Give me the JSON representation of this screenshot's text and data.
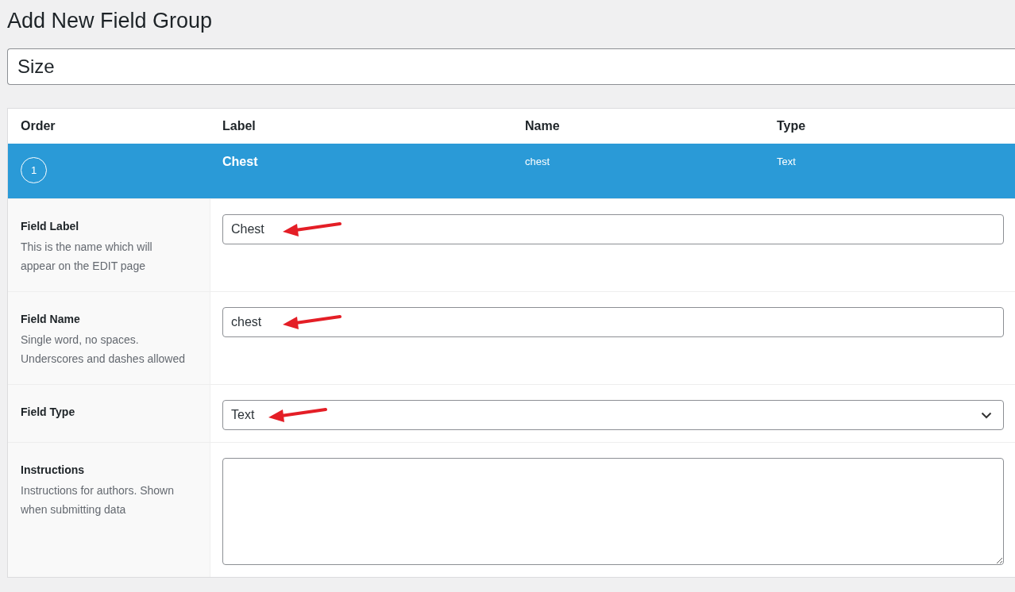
{
  "page": {
    "title": "Add New Field Group"
  },
  "group_title": {
    "value": "Size"
  },
  "table": {
    "columns": [
      "Order",
      "Label",
      "Name",
      "Type"
    ],
    "rows": [
      {
        "order": "1",
        "label": "Chest",
        "name": "chest",
        "type": "Text",
        "selected": true
      }
    ]
  },
  "settings": [
    {
      "kind": "text",
      "label": "Field Label",
      "description": "This is the name which will appear on the EDIT page",
      "value": "Chest",
      "arrow": true
    },
    {
      "kind": "text",
      "label": "Field Name",
      "description": "Single word, no spaces. Underscores and dashes allowed",
      "value": "chest",
      "arrow": true
    },
    {
      "kind": "select",
      "label": "Field Type",
      "value": "Text",
      "arrow": true
    },
    {
      "kind": "textarea",
      "label": "Instructions",
      "description": "Instructions for authors. Shown when submitting data",
      "arrow": false
    }
  ]
}
